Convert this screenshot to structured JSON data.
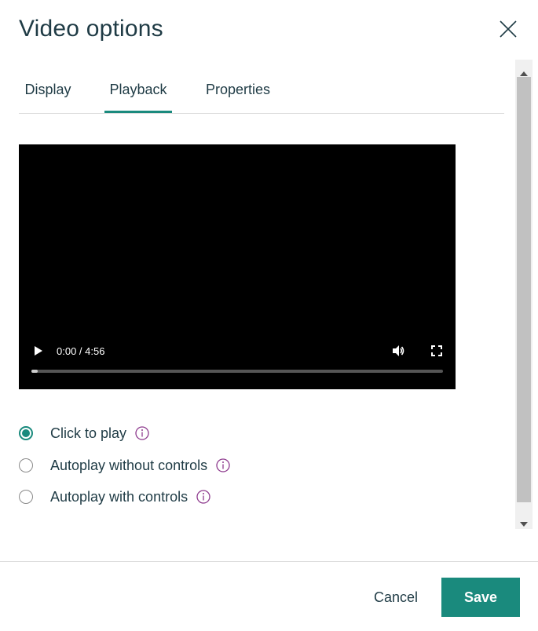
{
  "dialog": {
    "title": "Video options",
    "close_icon": "close-icon"
  },
  "tabs": [
    {
      "label": "Display",
      "active": false
    },
    {
      "label": "Playback",
      "active": true
    },
    {
      "label": "Properties",
      "active": false
    }
  ],
  "video": {
    "time": "0:00 / 4:56",
    "progress": 0.0
  },
  "playback_options": [
    {
      "label": "Click to play",
      "checked": true
    },
    {
      "label": "Autoplay without controls",
      "checked": false
    },
    {
      "label": "Autoplay with controls",
      "checked": false
    }
  ],
  "footer": {
    "cancel_label": "Cancel",
    "save_label": "Save"
  },
  "colors": {
    "accent": "#1a8a7d",
    "info_icon": "#8e3b8e",
    "text": "#1f3b45"
  }
}
